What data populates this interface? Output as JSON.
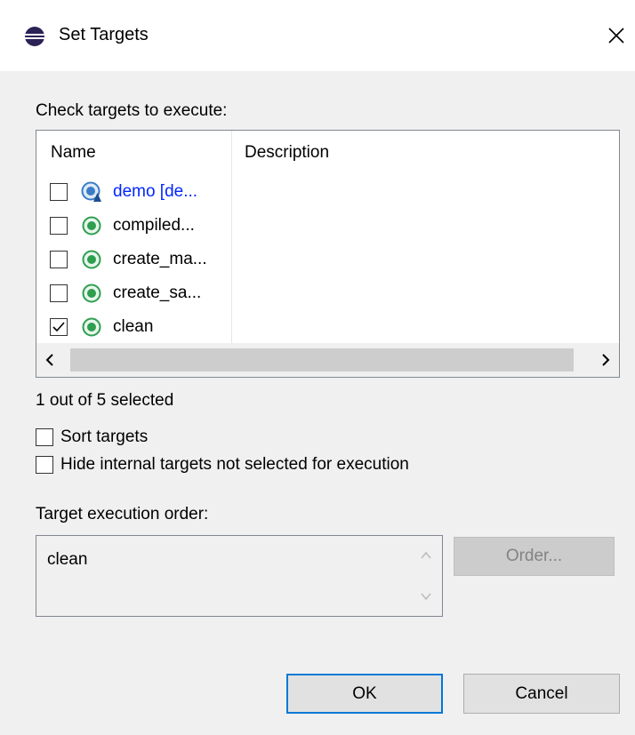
{
  "window": {
    "title": "Set Targets",
    "close_icon": "close-icon",
    "app_icon": "eclipse-icon"
  },
  "prompt": "Check targets to execute:",
  "table": {
    "columns": [
      "Name",
      "Description"
    ],
    "rows": [
      {
        "name": "demo [de...",
        "checked": false,
        "icon": "default-target-icon",
        "description": ""
      },
      {
        "name": "compiled...",
        "checked": false,
        "icon": "target-icon",
        "description": ""
      },
      {
        "name": "create_ma...",
        "checked": false,
        "icon": "target-icon",
        "description": ""
      },
      {
        "name": "create_sa...",
        "checked": false,
        "icon": "target-icon",
        "description": ""
      },
      {
        "name": "clean",
        "checked": true,
        "icon": "target-icon",
        "description": ""
      }
    ]
  },
  "selection_status": "1 out of 5 selected",
  "options": {
    "sort_label": "Sort targets",
    "sort_checked": false,
    "hide_label": "Hide internal targets not selected for execution",
    "hide_checked": false
  },
  "order": {
    "label": "Target execution order:",
    "value": "clean",
    "button_label": "Order..."
  },
  "buttons": {
    "ok": "OK",
    "cancel": "Cancel"
  },
  "colors": {
    "default_target_text": "#0026ff",
    "target_icon_green": "#2e9e4f",
    "accent_focus": "#0078d7"
  }
}
